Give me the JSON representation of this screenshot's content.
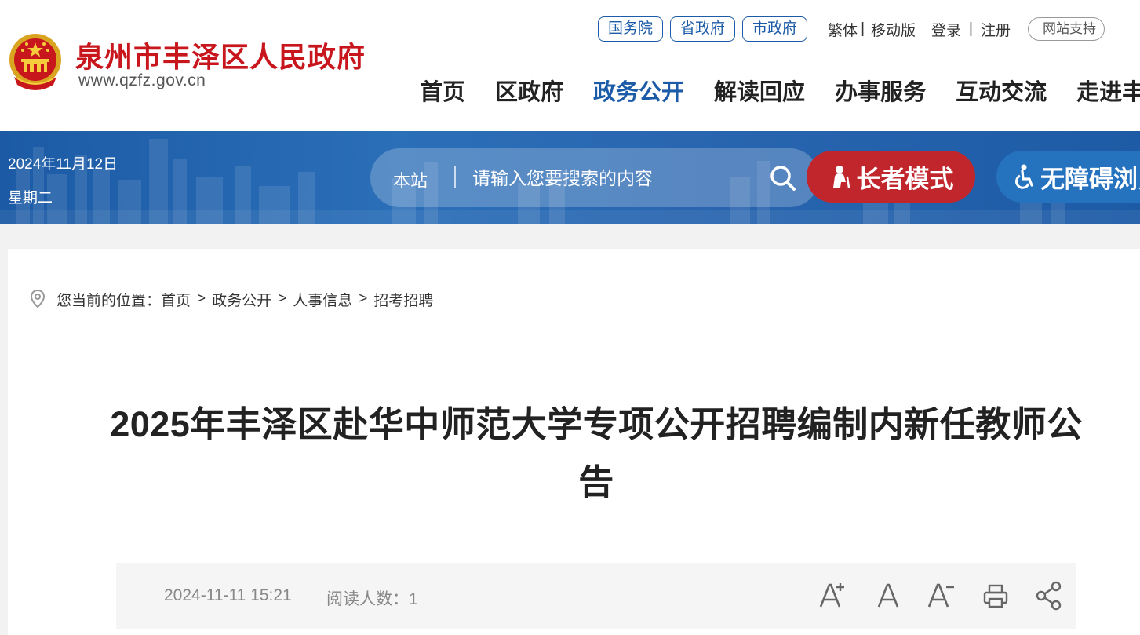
{
  "site": {
    "title": "泉州市丰泽区人民政府",
    "url": "www.qzfz.gov.cn"
  },
  "top_links": {
    "gov_buttons": [
      "国务院",
      "省政府",
      "市政府"
    ],
    "traditional": "繁体",
    "mobile": "移动版",
    "login": "登录",
    "register": "注册",
    "separator": "|",
    "site_support": "网站支持"
  },
  "nav": {
    "items": [
      "首页",
      "区政府",
      "政务公开",
      "解读回应",
      "办事服务",
      "互动交流",
      "走进丰泽"
    ],
    "active_index": 2
  },
  "banner": {
    "date": "2024年11月12日",
    "weekday": "星期二",
    "search_scope": "本站",
    "search_placeholder": "请输入您要搜索的内容",
    "elder_mode": "长者模式",
    "accessibility": "无障碍浏览"
  },
  "breadcrumb": {
    "prefix": "您当前的位置：",
    "items": [
      "首页",
      "政务公开",
      "人事信息",
      "招考招聘"
    ],
    "separator": ">"
  },
  "article": {
    "title": "2025年丰泽区赴华中师范大学专项公开招聘编制内新任教师公告",
    "date": "2024-11-11 15:21",
    "read_label": "阅读人数：",
    "read_count": "1"
  },
  "colors": {
    "brand_red": "#c8161d",
    "nav_active": "#1b5ba7",
    "banner_blue": "#1c5aa5",
    "elder_red": "#c0262c",
    "access_blue": "#2572bf"
  },
  "icons": [
    "national-emblem-icon",
    "search-icon",
    "elder-person-icon",
    "wheelchair-icon",
    "location-pin-icon",
    "font-increase-icon",
    "font-normal-icon",
    "font-decrease-icon",
    "print-icon",
    "share-icon"
  ]
}
